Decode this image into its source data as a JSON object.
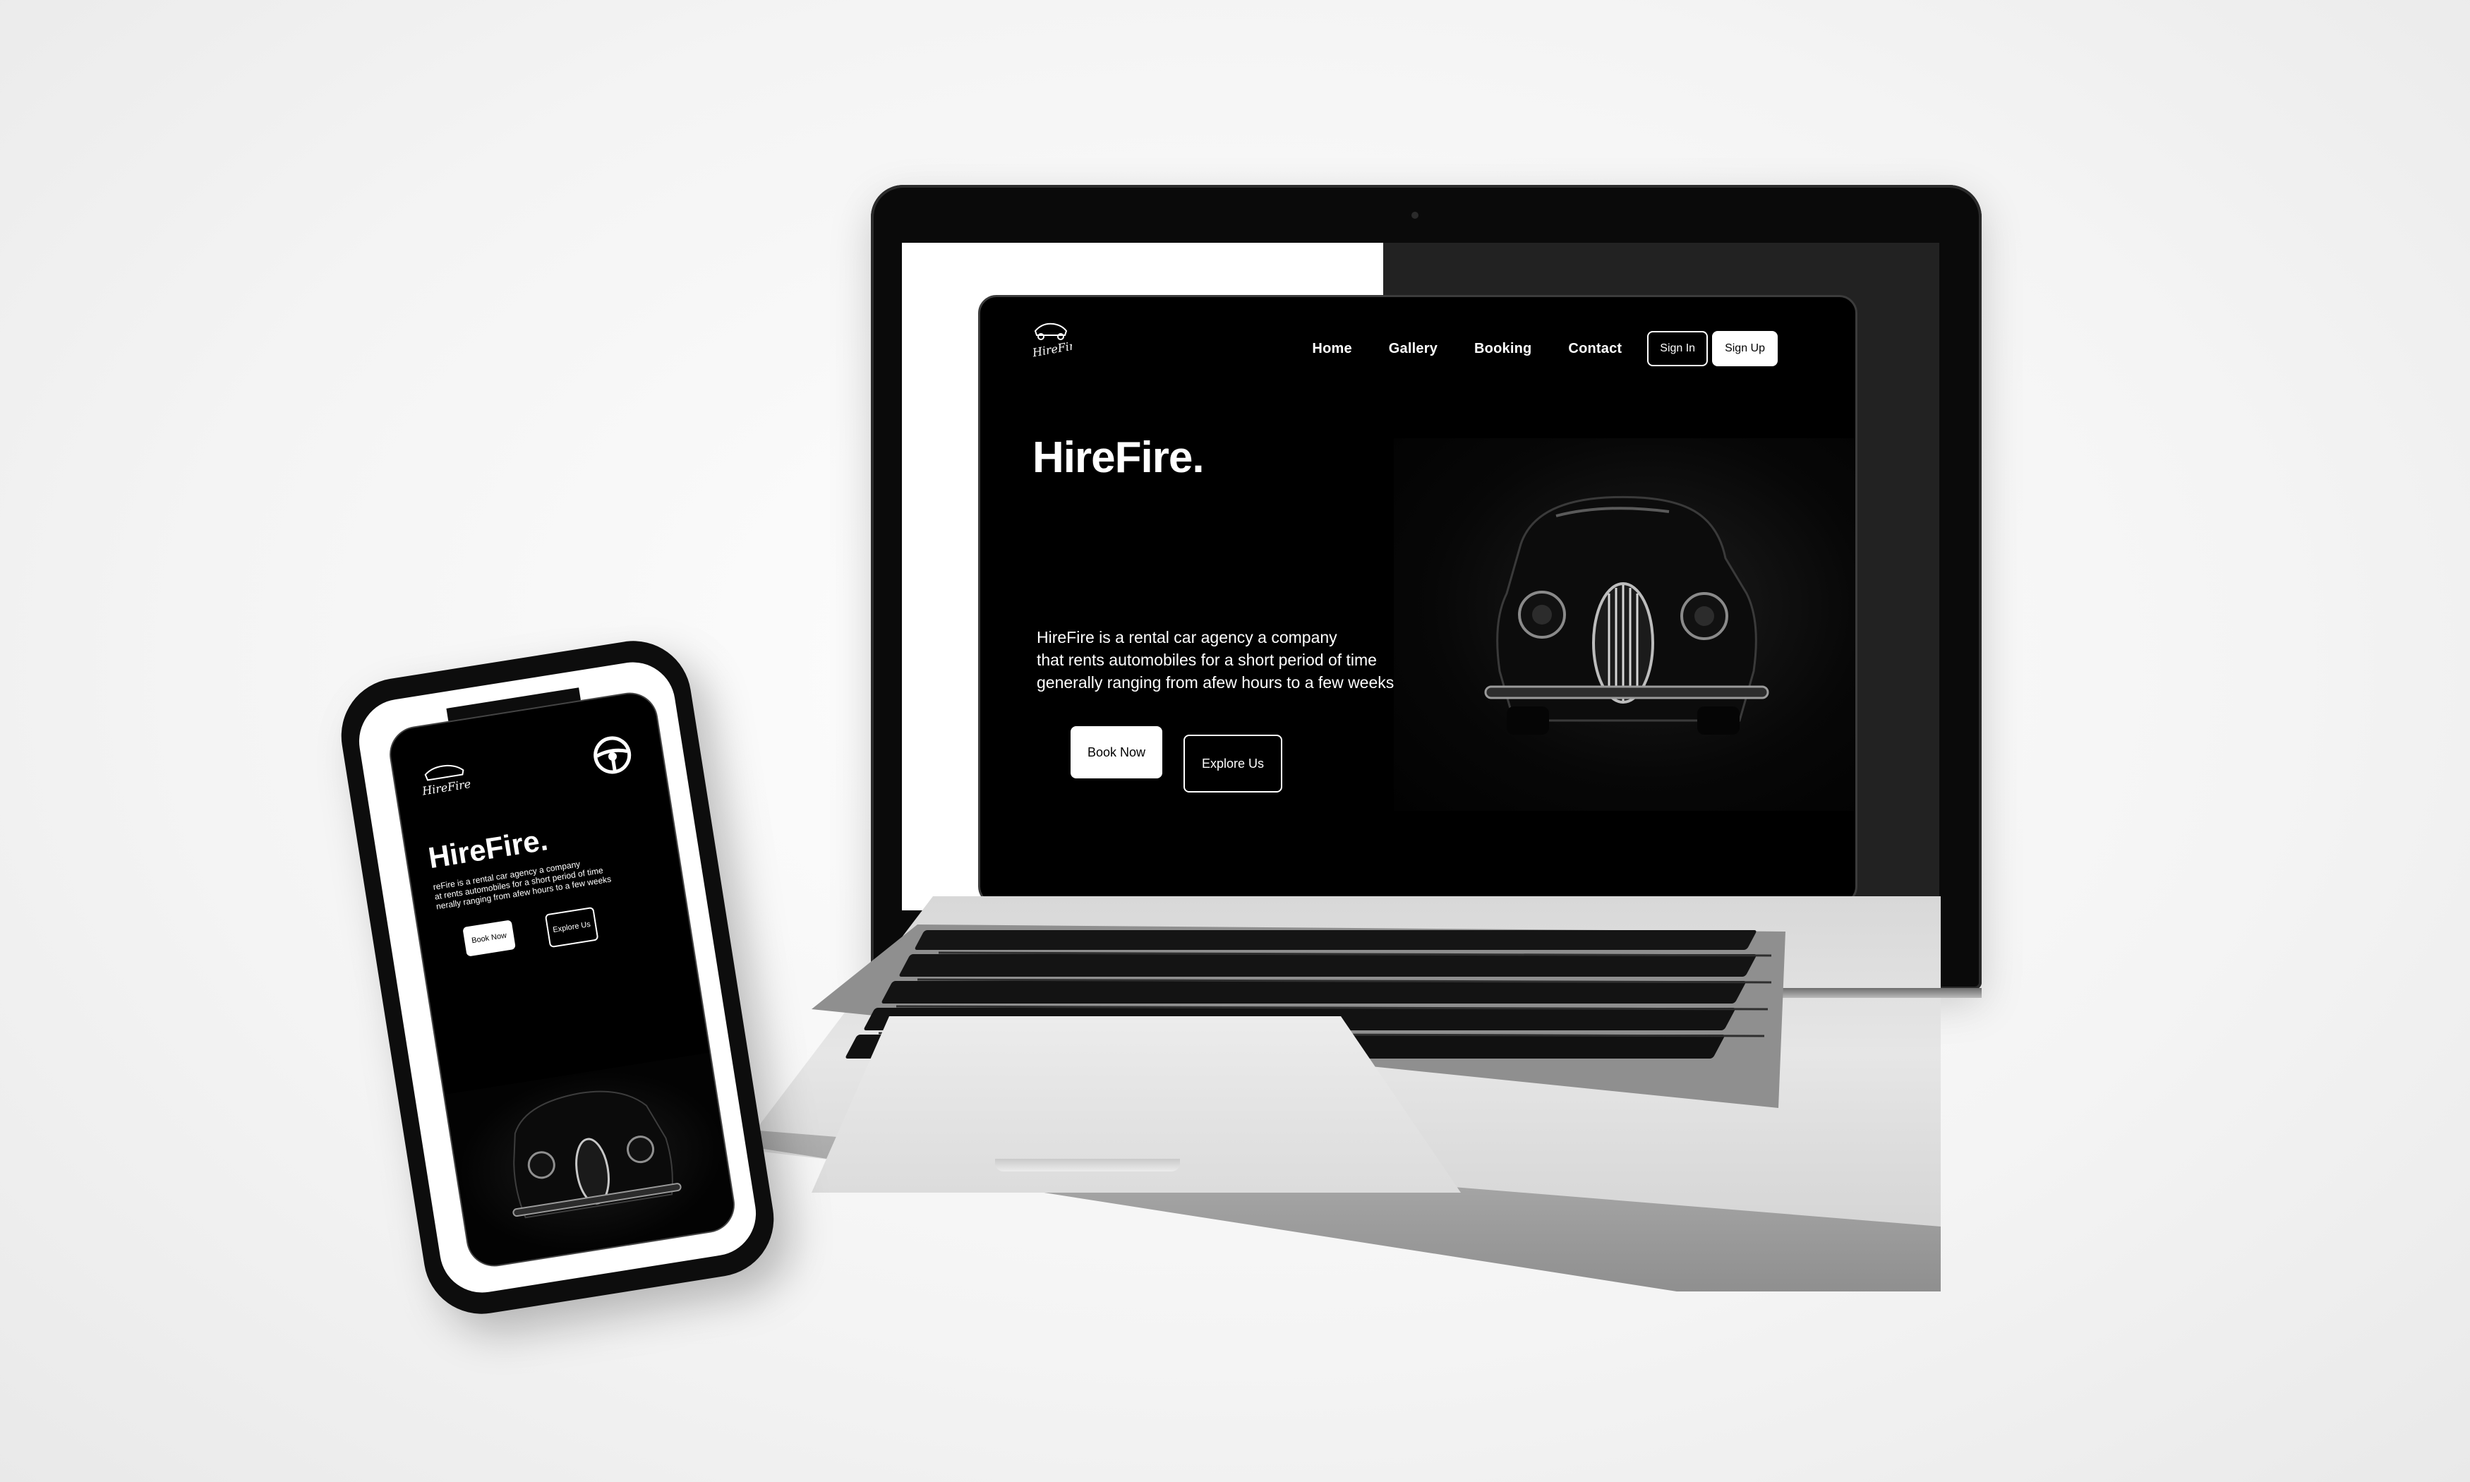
{
  "site": {
    "brand": "HireFire",
    "logo_text": "HireFire",
    "nav": {
      "home": "Home",
      "gallery": "Gallery",
      "booking": "Booking",
      "contact": "Contact",
      "sign_in": "Sign In",
      "sign_up": "Sign Up"
    },
    "hero": {
      "title": "HireFire.",
      "description_line1": "HireFire is a rental car agency a company",
      "description_line2": "that rents automobiles for a short period of time",
      "description_line3": "generally ranging from afew hours to a few weeks",
      "book_button": "Book Now",
      "explore_button": "Explore Us"
    }
  },
  "phone": {
    "title": "HireFire.",
    "description_line1": "reFire is a rental car agency a company",
    "description_line2": "at rents automobiles for a short period of time",
    "description_line3": "nerally ranging from afew hours to a few weeks",
    "book_button": "Book Now",
    "explore_button": "Explore Us",
    "icons": [
      "steering-wheel-icon"
    ]
  },
  "colors": {
    "background": "#ffffff",
    "card": "#000000",
    "accent": "#ffffff"
  }
}
